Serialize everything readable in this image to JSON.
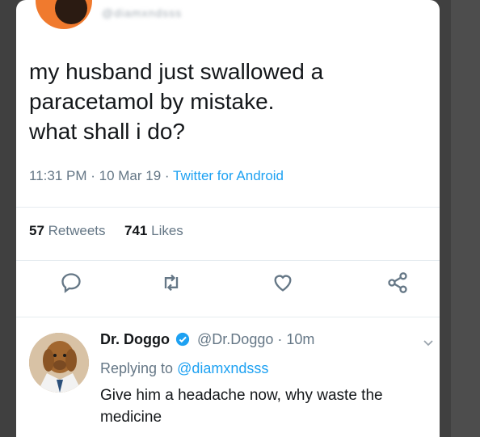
{
  "tweet": {
    "author_handle": "@diamxndsss",
    "text_lines": [
      "my husband just swallowed a",
      "paracetamol by mistake.",
      "what shall i do?"
    ],
    "time": "11:31 PM",
    "date": "10 Mar 19",
    "source": "Twitter for Android",
    "retweets_count": "57",
    "retweets_label": "Retweets",
    "likes_count": "741",
    "likes_label": "Likes",
    "icons": [
      "reply-icon",
      "retweet-icon",
      "like-icon",
      "share-icon"
    ]
  },
  "reply": {
    "name": "Dr. Doggo",
    "handle": "@Dr.Doggo",
    "age": "10m",
    "replying_prefix": "Replying to",
    "replying_to": "@diamxndsss",
    "text_lines": [
      "Give him a headache now, why waste the",
      "medicine"
    ]
  },
  "colors": {
    "accent": "#1da1f2",
    "text": "#14171a",
    "muted": "#657786",
    "background": "#404040"
  }
}
